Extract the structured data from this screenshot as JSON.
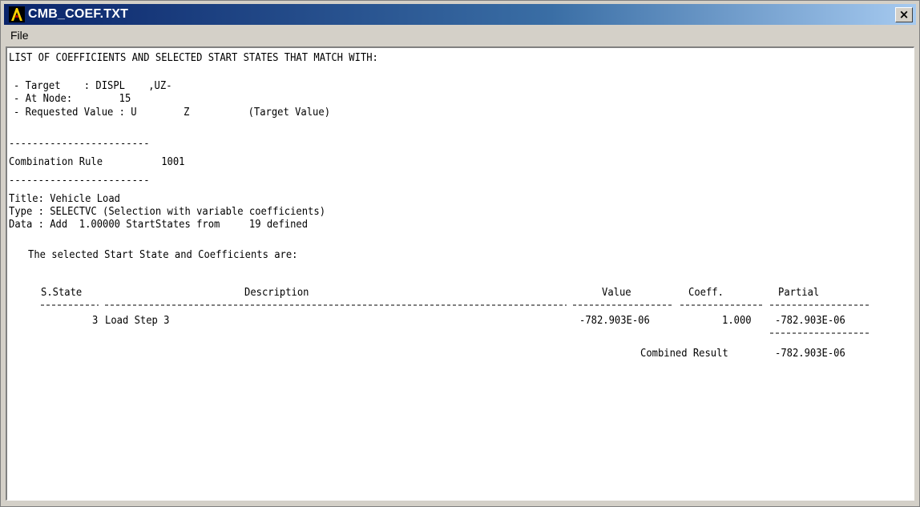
{
  "window": {
    "title": "CMB_COEF.TXT",
    "close_label": "×",
    "menu": [
      "File"
    ]
  },
  "report": {
    "header": "LIST OF COEFFICIENTS AND SELECTED START STATES THAT MATCH WITH:",
    "target": "- Target    : DISPL    ,UZ-",
    "at_node": "- At Node:        15",
    "requested_value": "- Requested Value : U        Z          (Target Value)",
    "separator": "------------------------",
    "combination_rule": "Combination Rule          1001",
    "title": "Title: Vehicle Load",
    "type": "Type : SELECTVC (Selection with variable coefficients)",
    "data": "Data : Add  1.00000 StartStates from     19 defined",
    "selected_intro": "The selected Start State and Coefficients are:",
    "columns": [
      "S.State",
      "Description",
      "Value",
      "Coeff.",
      "Partial"
    ],
    "rows": [
      {
        "s_state": "3",
        "description": "Load Step 3",
        "value": "-782.903E-06",
        "coeff": "1.000",
        "partial": "-782.903E-06"
      }
    ],
    "combined_label": "Combined Result",
    "combined_value": "-782.903E-06"
  },
  "colors": {
    "title_gradient_start": "#0a246a",
    "title_gradient_end": "#a6caf0",
    "window_bg": "#d4d0c8",
    "text_area_bg": "#ffffff"
  }
}
